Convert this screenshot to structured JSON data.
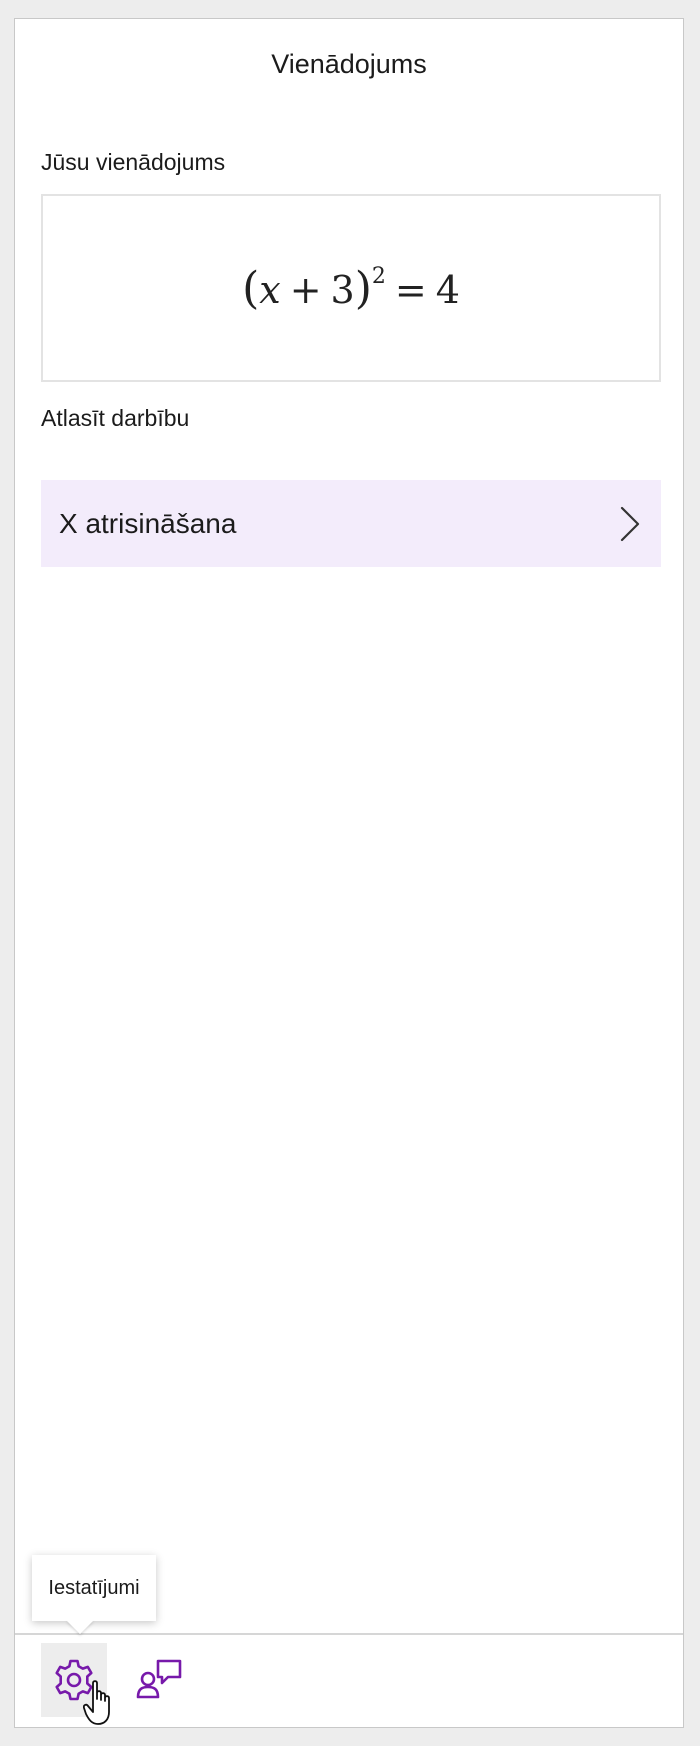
{
  "pane": {
    "title": "Vienādojums"
  },
  "equation_section": {
    "label": "Jūsu vienādojums",
    "equation": {
      "open_paren": "(",
      "variable": "x",
      "plus": "+",
      "constant": "3",
      "close_paren": ")",
      "exponent": "2",
      "equals": "=",
      "rhs": "4"
    }
  },
  "action_section": {
    "label": "Atlasīt darbību",
    "action_label": "X atrisināšana",
    "action_background": "#f3ecfb"
  },
  "bottom_bar": {
    "settings_icon": "gear-icon",
    "feedback_icon": "feedback-icon",
    "icon_color": "#7719aa",
    "tooltip": "Iestatījumi"
  }
}
